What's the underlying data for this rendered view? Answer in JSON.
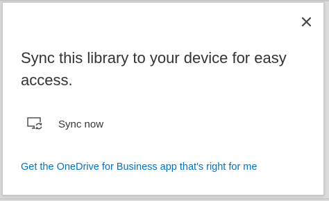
{
  "dialog": {
    "headline": "Sync this library to your device for easy access.",
    "close_icon": "close-icon",
    "sync_action": {
      "label": "Sync now",
      "icon": "sync-device-icon"
    },
    "link_text": "Get the OneDrive for Business app that's right for me"
  },
  "colors": {
    "link": "#0072c6",
    "text": "#333333",
    "background": "#ffffff"
  }
}
